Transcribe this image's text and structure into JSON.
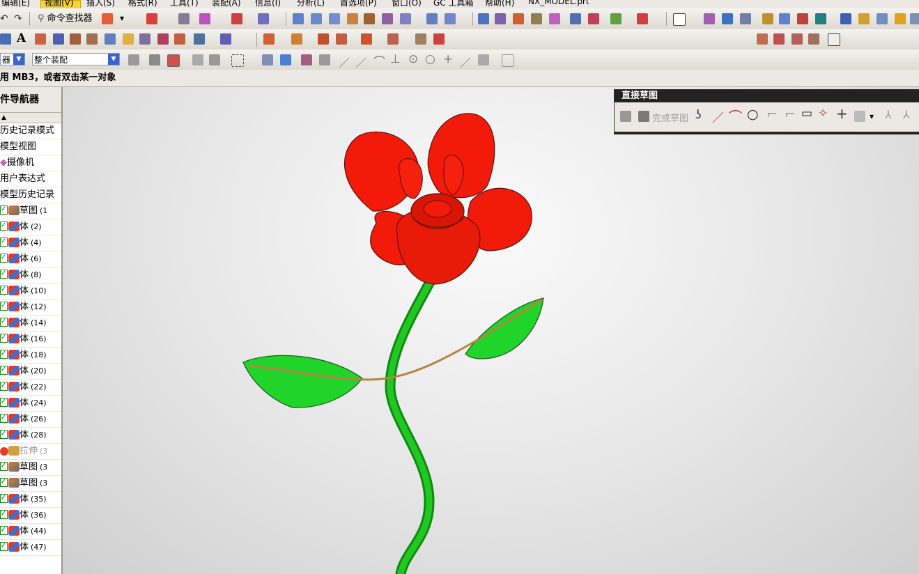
{
  "menubar": {
    "items": [
      "编辑(E)",
      "视图(V)",
      "插入(S)",
      "格式(R)",
      "工具(T)",
      "装配(A)",
      "信息(I)",
      "分析(L)",
      "首选项(P)",
      "窗口(O)",
      "GC 工具箱",
      "帮助(H)",
      "NX_MODEL.prt"
    ]
  },
  "toolbar": {
    "command_finder_label": "命令查找器"
  },
  "selection_bar": {
    "filter_value": "器",
    "scope_value": "整个装配"
  },
  "status": {
    "prompt": "用 MB3，或者双击某一对象"
  },
  "navigator": {
    "title": "件导航器",
    "items": [
      {
        "label": "历史记录模式",
        "type": "text"
      },
      {
        "label": "模型视图",
        "type": "text"
      },
      {
        "label": "摄像机",
        "type": "camera"
      },
      {
        "label": "用户表达式",
        "type": "text"
      },
      {
        "label": "模型历史记录",
        "type": "text"
      },
      {
        "label": "草图",
        "num": "(1",
        "type": "sketch"
      },
      {
        "label": "体",
        "num": "(2)",
        "type": "body"
      },
      {
        "label": "体",
        "num": "(4)",
        "type": "body"
      },
      {
        "label": "体",
        "num": "(6)",
        "type": "body"
      },
      {
        "label": "体",
        "num": "(8)",
        "type": "body"
      },
      {
        "label": "体",
        "num": "(10)",
        "type": "body"
      },
      {
        "label": "体",
        "num": "(12)",
        "type": "body"
      },
      {
        "label": "体",
        "num": "(14)",
        "type": "body"
      },
      {
        "label": "体",
        "num": "(16)",
        "type": "body"
      },
      {
        "label": "体",
        "num": "(18)",
        "type": "body"
      },
      {
        "label": "体",
        "num": "(20)",
        "type": "body"
      },
      {
        "label": "体",
        "num": "(22)",
        "type": "body"
      },
      {
        "label": "体",
        "num": "(24)",
        "type": "body"
      },
      {
        "label": "体",
        "num": "(26)",
        "type": "body"
      },
      {
        "label": "体",
        "num": "(28)",
        "type": "body"
      },
      {
        "label": "拉伸",
        "num": "(3",
        "type": "extrude-disabled"
      },
      {
        "label": "草图",
        "num": "(3",
        "type": "sketch"
      },
      {
        "label": "草图",
        "num": "(3",
        "type": "sketch"
      },
      {
        "label": "体",
        "num": "(35)",
        "type": "body"
      },
      {
        "label": "体",
        "num": "(36)",
        "type": "body"
      },
      {
        "label": "体",
        "num": "(44)",
        "type": "body"
      },
      {
        "label": "体",
        "num": "(47)",
        "type": "body"
      }
    ]
  },
  "sketch_panel": {
    "title": "直接草图",
    "finish_label": "完成草图"
  },
  "model": {
    "petal_color": "#f21a08",
    "leaf_color": "#22d82a",
    "stem_color": "#14b414",
    "vein_color": "#b48440"
  }
}
